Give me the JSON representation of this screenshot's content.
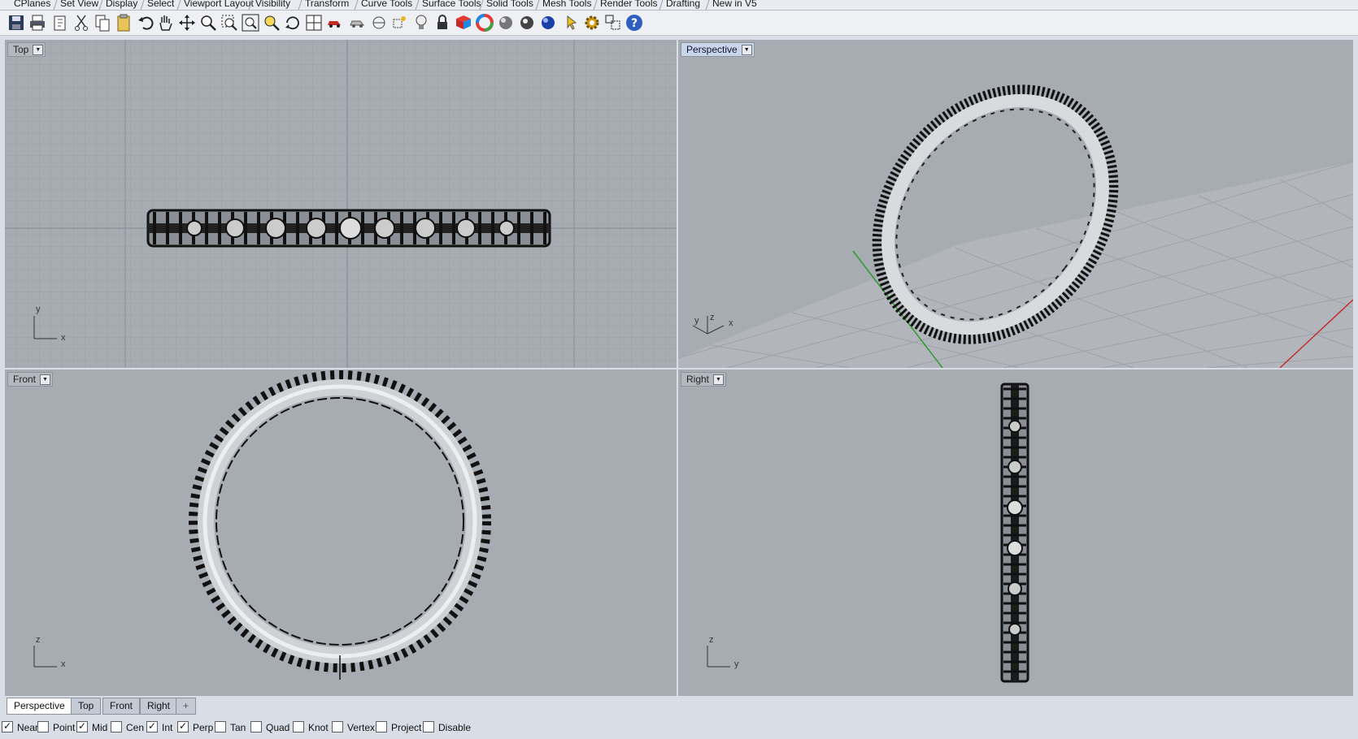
{
  "toolbar_tabs": [
    "CPlanes",
    "Set View",
    "Display",
    "Select",
    "Viewport Layout",
    "Visibility",
    "Transform",
    "Curve Tools",
    "Surface Tools",
    "Solid Tools",
    "Mesh Tools",
    "Render Tools",
    "Drafting",
    "New in V5"
  ],
  "toolbar_icons": [
    "save-icon",
    "print-icon",
    "new-doc-icon",
    "cut-icon",
    "copy-icon",
    "paste-icon",
    "undo-icon",
    "pan-hand-icon",
    "move-view-icon",
    "zoom-icon",
    "zoom-window-icon",
    "zoom-extents-icon",
    "zoom-selected-icon",
    "rotate-view-icon",
    "four-viewports-icon",
    "car-icon",
    "shade-car-icon",
    "cplane-icon",
    "point-icon",
    "lightbulb-icon",
    "lock-icon",
    "render-material-icon",
    "color-wheel-icon",
    "sphere-shaded-icon",
    "sphere-render-icon",
    "sphere-blue-icon",
    "pointer-icon",
    "gear-icon",
    "options-icon",
    "help-icon"
  ],
  "viewports": {
    "top": {
      "label": "Top",
      "axis_v": "y",
      "axis_h": "x"
    },
    "perspective": {
      "label": "Perspective",
      "axis_a": "y",
      "axis_b": "z",
      "axis_c": "x"
    },
    "front": {
      "label": "Front",
      "axis_v": "z",
      "axis_h": "x"
    },
    "right": {
      "label": "Right",
      "axis_v": "z",
      "axis_h": "y"
    }
  },
  "viewport_tabs": [
    {
      "label": "Perspective",
      "active": true
    },
    {
      "label": "Top",
      "active": false
    },
    {
      "label": "Front",
      "active": false
    },
    {
      "label": "Right",
      "active": false
    }
  ],
  "add_tab_glyph": "+",
  "osnaps": [
    {
      "label": "Near",
      "checked": true
    },
    {
      "label": "Point",
      "checked": false
    },
    {
      "label": "Mid",
      "checked": true
    },
    {
      "label": "Cen",
      "checked": false
    },
    {
      "label": "Int",
      "checked": true
    },
    {
      "label": "Perp",
      "checked": true
    },
    {
      "label": "Tan",
      "checked": false
    },
    {
      "label": "Quad",
      "checked": false
    },
    {
      "label": "Knot",
      "checked": false
    },
    {
      "label": "Vertex",
      "checked": false
    },
    {
      "label": "Project",
      "checked": false
    },
    {
      "label": "Disable",
      "checked": false
    }
  ],
  "colors": {
    "viewport_bg": "#a7abb2",
    "grid_minor": "#9da1a8",
    "grid_major": "#8b9098",
    "x_axis": "#c0302a",
    "y_axis": "#2f9a2f"
  }
}
